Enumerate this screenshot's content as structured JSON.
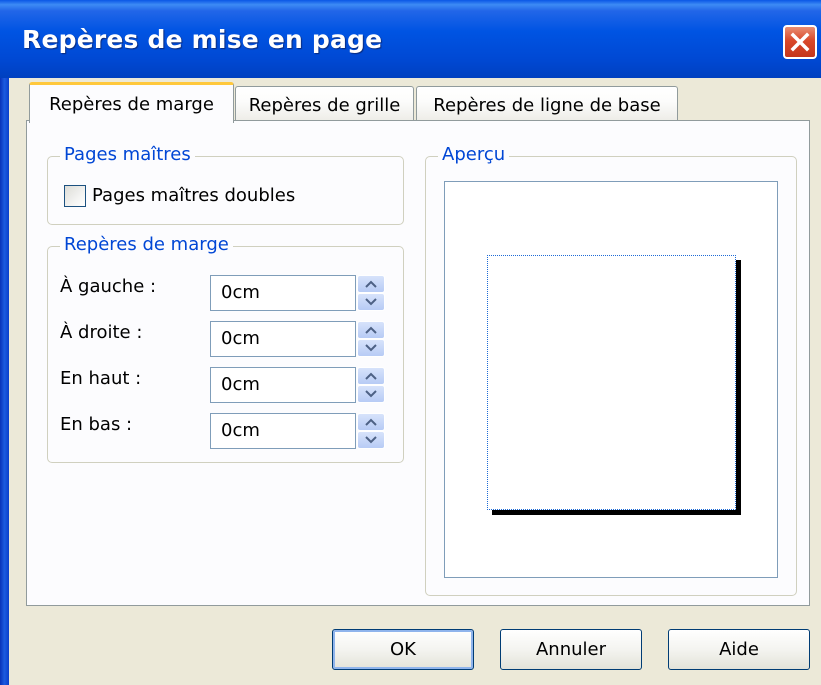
{
  "window": {
    "title": "Repères de mise en page",
    "close_icon": "close-icon"
  },
  "tabs": [
    {
      "label": "Repères de marge",
      "active": true
    },
    {
      "label": "Repères de grille",
      "active": false
    },
    {
      "label": "Repères de ligne de base",
      "active": false
    }
  ],
  "master_pages": {
    "title": "Pages maîtres",
    "checkbox_label": "Pages maîtres doubles",
    "checked": false
  },
  "margins": {
    "title": "Repères de marge",
    "fields": [
      {
        "label": "À gauche :",
        "value": "0cm"
      },
      {
        "label": "À droite :",
        "value": "0cm"
      },
      {
        "label": "En haut :",
        "value": "0cm"
      },
      {
        "label": "En bas :",
        "value": "0cm"
      }
    ]
  },
  "preview": {
    "title": "Aperçu"
  },
  "buttons": {
    "ok": "OK",
    "cancel": "Annuler",
    "help": "Aide"
  },
  "colors": {
    "title_bar": "#0054e3",
    "group_title": "#0046d5",
    "close_button": "#d9482a",
    "tab_highlight": "#ffc83c"
  }
}
